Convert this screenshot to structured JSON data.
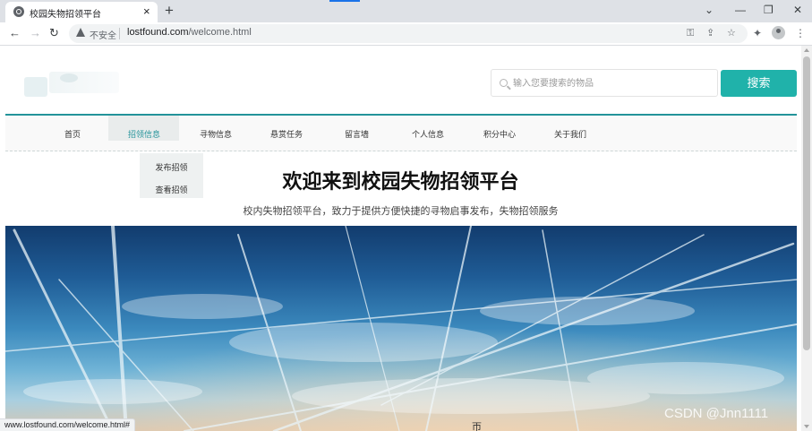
{
  "browser": {
    "tab_title": "校园失物招领平台",
    "tab_close": "×",
    "new_tab": "+",
    "window_controls": {
      "chevron": "⌄",
      "minimize": "—",
      "maximize": "❐",
      "close": "✕"
    },
    "security_label": "不安全",
    "url_host": "lostfound.com",
    "url_path": "/welcome.html",
    "status_url": "www.lostfound.com/welcome.html#",
    "nav_back": "←",
    "nav_forward": "→",
    "nav_reload": "↻",
    "toolbar_icons": {
      "key": "⚿",
      "share": "⇪",
      "star": "☆",
      "extensions": "✦",
      "menu": "⋮"
    }
  },
  "header": {
    "search_placeholder": "输入您要搜索的物品",
    "search_button": "搜索"
  },
  "nav": {
    "items": [
      {
        "label": "首页"
      },
      {
        "label": "招领信息",
        "active": true
      },
      {
        "label": "寻物信息"
      },
      {
        "label": "悬赏任务"
      },
      {
        "label": "留言墙"
      },
      {
        "label": "个人信息"
      },
      {
        "label": "积分中心"
      },
      {
        "label": "关于我们"
      }
    ],
    "dropdown": [
      {
        "label": "发布招领"
      },
      {
        "label": "查看招领"
      }
    ]
  },
  "main": {
    "title": "欢迎来到校园失物招领平台",
    "subtitle": "校内失物招领平台，致力于提供方便快捷的寻物启事发布，失物招领服务",
    "banner_mark": "帀"
  },
  "watermark": "CSDN @Jnn1111",
  "colors": {
    "accent": "#20b2aa",
    "nav_line": "#23939a"
  }
}
